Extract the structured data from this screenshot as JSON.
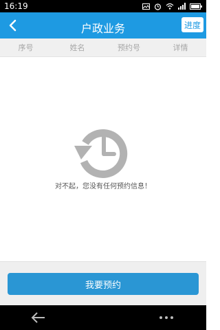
{
  "status_bar": {
    "time": "16:19"
  },
  "header": {
    "title": "户政业务",
    "progress_label": "进度"
  },
  "table": {
    "columns": [
      "序号",
      "姓名",
      "预约号",
      "详情"
    ]
  },
  "empty_state": {
    "message": "对不起，您没有任何预约信息！"
  },
  "footer": {
    "reserve_label": "我要预约"
  },
  "colors": {
    "accent": "#1e9ae2",
    "button": "#2a96d4",
    "icon_gray": "#b2b2b2"
  }
}
